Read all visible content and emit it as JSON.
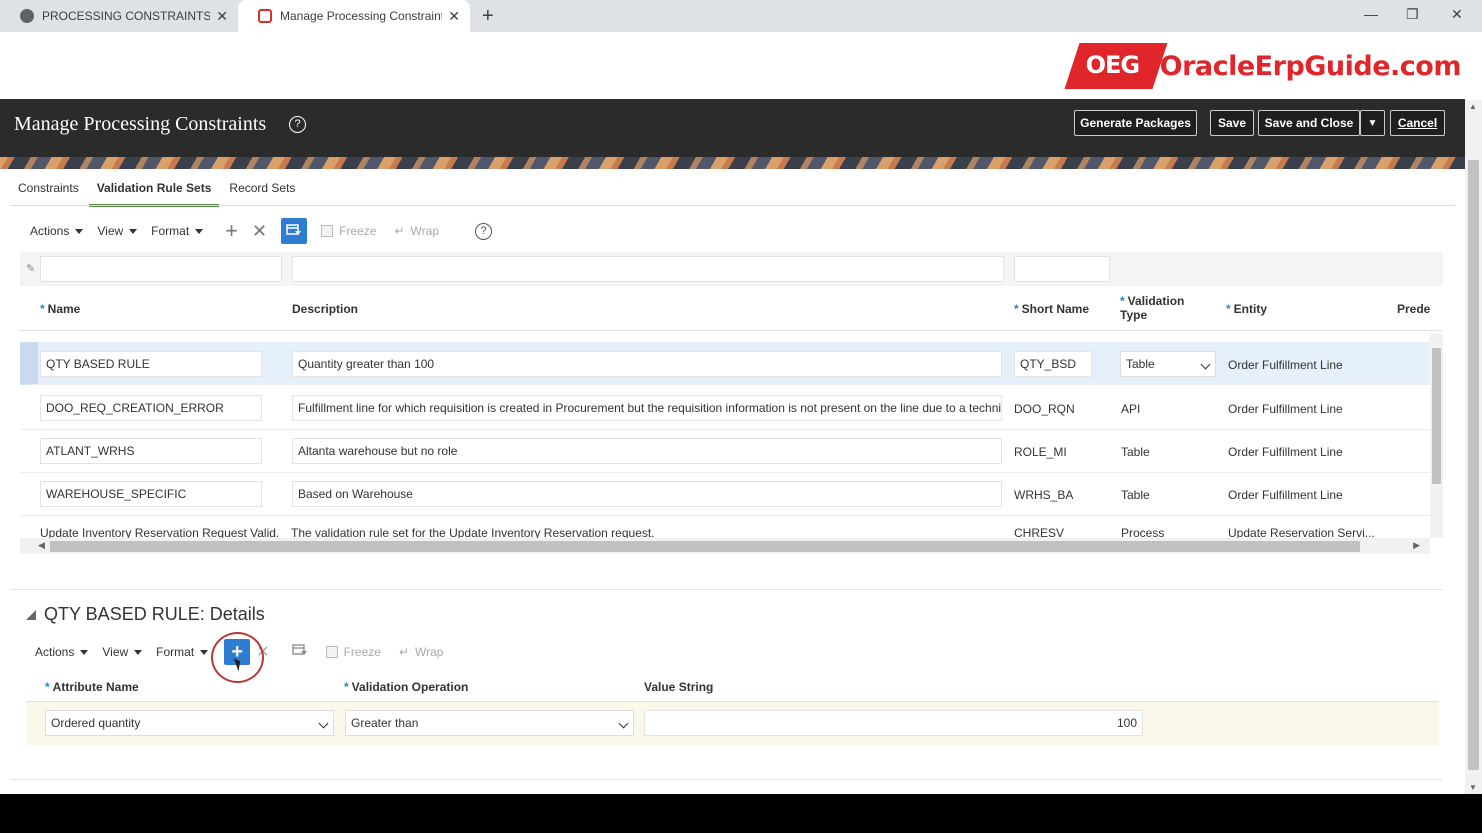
{
  "browser": {
    "tabs": [
      {
        "title": "PROCESSING CONSTRAINTS.pdf",
        "active": false
      },
      {
        "title": "Manage Processing Constraints -",
        "active": true
      }
    ],
    "new_tab": "+",
    "close_glyph": "✕",
    "win_min": "—",
    "win_max": "❐",
    "win_close": "✕"
  },
  "logo": {
    "badge": "OEG",
    "text": "OracleErpGuide.com",
    "color": "#e0262b"
  },
  "header": {
    "title": "Manage Processing Constraints",
    "help": "?",
    "buttons": {
      "generate": "Generate Packages",
      "save": "Save",
      "save_close": "Save and Close",
      "dropdown": "▼",
      "cancel": "Cancel"
    }
  },
  "page_tabs": [
    "Constraints",
    "Validation Rule Sets",
    "Record Sets"
  ],
  "toolbar": {
    "actions": "Actions",
    "view": "View",
    "format": "Format",
    "add": "+",
    "delete": "✕",
    "freeze": "Freeze",
    "wrap": "Wrap",
    "help": "?"
  },
  "table": {
    "columns": {
      "name": "Name",
      "description": "Description",
      "short_name": "Short Name",
      "validation_type": "Validation Type",
      "entity": "Entity",
      "predecessor": "Prede"
    },
    "required_mark": "*",
    "rows": [
      {
        "name": "QTY BASED RULE",
        "description": "Quantity greater than 100",
        "short_name": "QTY_BSD",
        "validation_type": "Table",
        "entity": "Order Fulfillment Line",
        "selected": true
      },
      {
        "name": "DOO_REQ_CREATION_ERROR",
        "description": "Fulfillment line for which requisition is created in Procurement but the requisition information is not present on the line due to a technical f",
        "short_name": "DOO_RQN",
        "validation_type": "API",
        "entity": "Order Fulfillment Line"
      },
      {
        "name": "ATLANT_WRHS",
        "description": "Altanta warehouse but no role",
        "short_name": "ROLE_MI",
        "validation_type": "Table",
        "entity": "Order Fulfillment Line"
      },
      {
        "name": "WAREHOUSE_SPECIFIC",
        "description": "Based on Warehouse",
        "short_name": "WRHS_BA",
        "validation_type": "Table",
        "entity": "Order Fulfillment Line"
      },
      {
        "name": "Update Inventory Reservation Request Valid...",
        "description": "The validation rule set for the Update Inventory Reservation request.",
        "short_name": "CHRESV",
        "validation_type": "Process",
        "entity": "Update Reservation Servi..."
      }
    ]
  },
  "details": {
    "title": "QTY BASED RULE: Details",
    "toolbar": {
      "actions": "Actions",
      "view": "View",
      "format": "Format",
      "add": "+",
      "delete": "✕",
      "freeze": "Freeze",
      "wrap": "Wrap"
    },
    "columns": {
      "attribute": "Attribute Name",
      "operation": "Validation Operation",
      "value": "Value String"
    },
    "row": {
      "attribute": "Ordered quantity",
      "operation": "Greater than",
      "value": "100"
    }
  }
}
